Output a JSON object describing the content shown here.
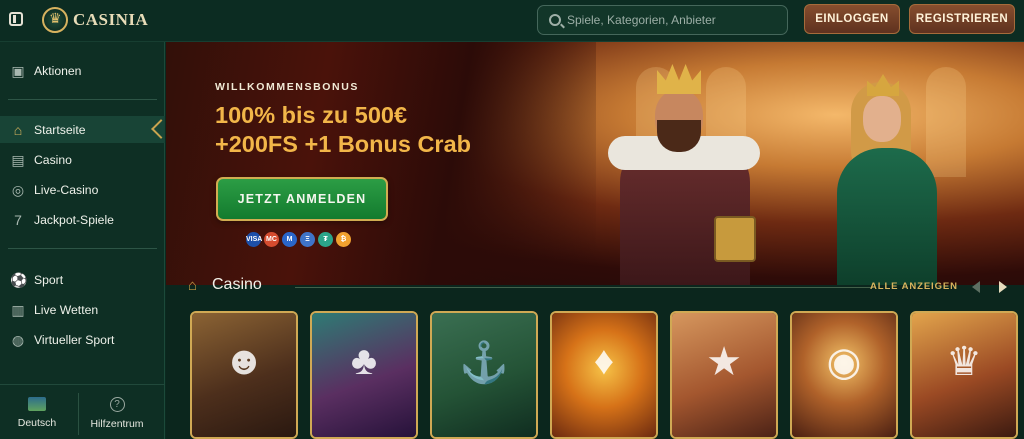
{
  "header": {
    "brand": "CASINIA",
    "search": {
      "placeholder": "Spiele, Kategorien, Anbieter"
    },
    "login_label": "EINLOGGEN",
    "register_label": "REGISTRIEREN"
  },
  "sidebar": {
    "items": [
      {
        "label": "Aktionen",
        "icon": "gift-icon"
      },
      {
        "label": "Startseite",
        "icon": "home-icon",
        "active": true
      },
      {
        "label": "Casino",
        "icon": "casino-icon"
      },
      {
        "label": "Live-Casino",
        "icon": "live-icon"
      },
      {
        "label": "Jackpot-Spiele",
        "icon": "seven-icon"
      },
      {
        "label": "Sport",
        "icon": "ball-icon"
      },
      {
        "label": "Live Wetten",
        "icon": "live-bet-icon"
      },
      {
        "label": "Virtueller Sport",
        "icon": "gamepad-icon"
      }
    ],
    "language_label": "Deutsch",
    "help_label": "Hilfzentrum"
  },
  "hero": {
    "eyebrow": "WILLKOMMENSBONUS",
    "title_line1": "100% bis zu 500€",
    "title_line2": "+200FS +1 Bonus Crab",
    "cta_label": "JETZT ANMELDEN",
    "payments": [
      {
        "name": "visa",
        "label": "VISA",
        "color": "#1d4fa8"
      },
      {
        "name": "mastercard",
        "label": "MC",
        "color": "#d44c2f"
      },
      {
        "name": "maestro",
        "label": "M",
        "color": "#2a66c9"
      },
      {
        "name": "ethereum",
        "label": "Ξ",
        "color": "#3f74c8"
      },
      {
        "name": "tether",
        "label": "₮",
        "color": "#2ba58a"
      },
      {
        "name": "bitcoin",
        "label": "₿",
        "color": "#f1a12f"
      }
    ]
  },
  "casino": {
    "title": "Casino",
    "see_all": "ALLE ANZEIGEN",
    "tiles": [
      {
        "icon": "explorer-icon",
        "glyph": "☻"
      },
      {
        "icon": "leprechaun-icon",
        "glyph": "♣"
      },
      {
        "icon": "fisherman-icon",
        "glyph": "⚓"
      },
      {
        "icon": "gem-icon",
        "glyph": "♦"
      },
      {
        "icon": "cowboy-icon",
        "glyph": "★"
      },
      {
        "icon": "roulette-icon",
        "glyph": "◉"
      },
      {
        "icon": "party-icon",
        "glyph": "♛"
      }
    ]
  },
  "colors": {
    "accent_gold": "#d0a954",
    "cta_green": "#1d8a38",
    "button_brown": "#7a4528"
  }
}
